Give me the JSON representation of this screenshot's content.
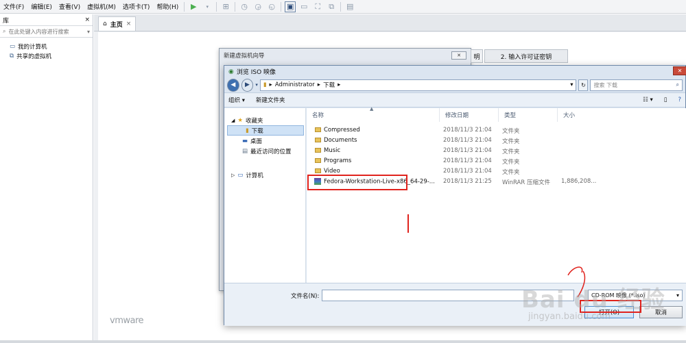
{
  "menubar": {
    "items": [
      "文件(F)",
      "编辑(E)",
      "查看(V)",
      "虚拟机(M)",
      "选项卡(T)",
      "帮助(H)"
    ]
  },
  "library": {
    "title": "库",
    "close": "×",
    "search_placeholder": "在此处键入内容进行搜索",
    "items": [
      "我的计算机",
      "共享的虚拟机"
    ]
  },
  "tabs": {
    "home_label": "主页",
    "home_close": "×"
  },
  "branding": {
    "logo_text": "vmware"
  },
  "wizard": {
    "title": "新建虚拟机向导",
    "step_partial": "明",
    "step2": "2. 输入许可证密钥"
  },
  "dialog": {
    "title": "浏览 ISO 映像",
    "close": "✕",
    "address": {
      "segments": [
        "Administrator",
        "下载"
      ]
    },
    "search_placeholder": "搜索 下载",
    "toolbar": {
      "organize": "组织 ▾",
      "new_folder": "新建文件夹"
    },
    "nav": {
      "favorites": "收藏夹",
      "favorites_items": [
        "下载",
        "桌面",
        "最近访问的位置"
      ],
      "computer": "计算机"
    },
    "columns": [
      "名称",
      "修改日期",
      "类型",
      "大小"
    ],
    "files": [
      {
        "name": "Compressed",
        "date": "2018/11/3 21:04",
        "type": "文件夹",
        "size": ""
      },
      {
        "name": "Documents",
        "date": "2018/11/3 21:04",
        "type": "文件夹",
        "size": ""
      },
      {
        "name": "Music",
        "date": "2018/11/3 21:04",
        "type": "文件夹",
        "size": ""
      },
      {
        "name": "Programs",
        "date": "2018/11/3 21:04",
        "type": "文件夹",
        "size": ""
      },
      {
        "name": "Video",
        "date": "2018/11/3 21:04",
        "type": "文件夹",
        "size": ""
      },
      {
        "name": "Fedora-Workstation-Live-x86_64-29-...",
        "date": "2018/11/3 21:25",
        "type": "WinRAR 压缩文件",
        "size": "1,886,208..."
      }
    ],
    "filename_label": "文件名(N):",
    "filename_value": "",
    "filetype": "CD-ROM 映像 (*.iso)",
    "open": "打开(O)",
    "cancel": "取消"
  },
  "watermark": {
    "line1": "Bai du 经验",
    "line2": "jingyan.baidu.com"
  },
  "colors": {
    "highlight": "#e0221c",
    "accent": "#4a8ccf"
  }
}
